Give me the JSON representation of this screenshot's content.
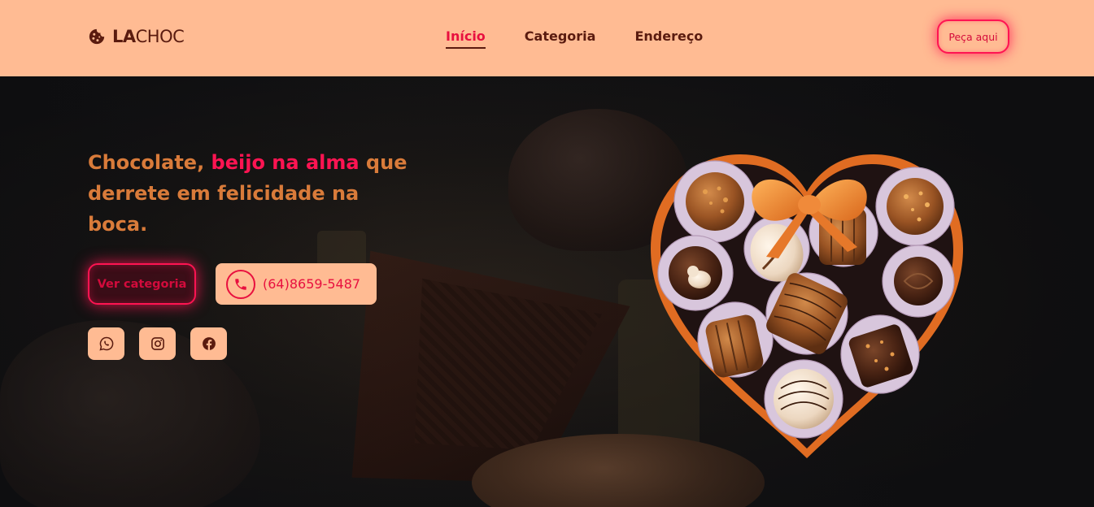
{
  "header": {
    "logo": {
      "prefix": "LA",
      "suffix": "CHOC",
      "icon": "cookie-icon"
    },
    "nav": [
      {
        "label": "Início",
        "active": true
      },
      {
        "label": "Categoria",
        "active": false
      },
      {
        "label": "Endereço",
        "active": false
      }
    ],
    "order_button": "Peça aqui"
  },
  "hero": {
    "headline_part1": "Chocolate, ",
    "headline_accent": "beijo na alma",
    "headline_part2": "que derrete em felicidade na boca.",
    "category_button": "Ver categoria",
    "phone": "(64)8659-5487",
    "phone_icon": "phone-icon",
    "social": [
      {
        "icon": "whatsapp-icon"
      },
      {
        "icon": "instagram-icon"
      },
      {
        "icon": "facebook-icon"
      }
    ]
  },
  "colors": {
    "header_bg": "#ffbb93",
    "accent": "#ff1452",
    "headline": "#d97b3a",
    "dark_text": "#5a1b0f"
  }
}
